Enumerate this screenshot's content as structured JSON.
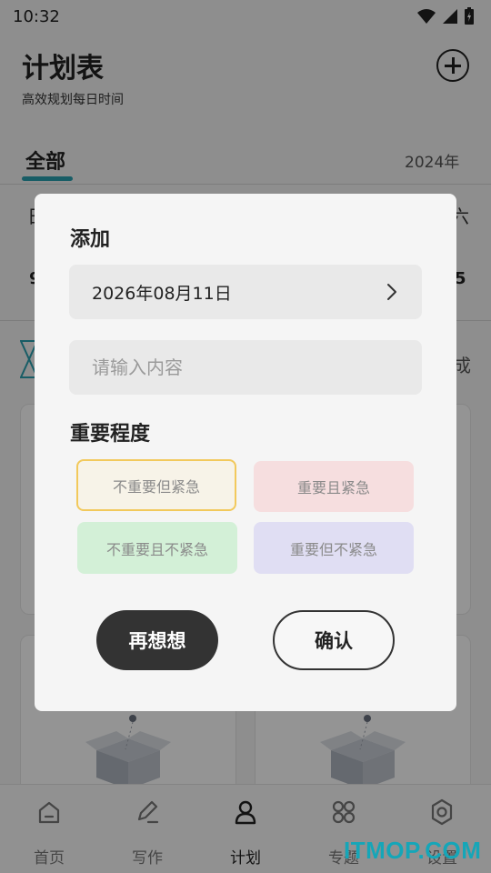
{
  "status_bar": {
    "time": "10:32"
  },
  "header": {
    "title": "计划表",
    "subtitle": "高效规划每日时间"
  },
  "tabs": {
    "active_label": "全部",
    "year": "2024年"
  },
  "week": {
    "left_weekday": "日",
    "right_weekday": "六",
    "left_day": "9",
    "right_day": "5"
  },
  "filter": {
    "right_label": "成"
  },
  "nav": {
    "items": [
      {
        "label": "首页",
        "icon": "home-icon"
      },
      {
        "label": "写作",
        "icon": "pencil-icon"
      },
      {
        "label": "计划",
        "icon": "person-icon",
        "active": true
      },
      {
        "label": "专题",
        "icon": "grid-icon"
      },
      {
        "label": "设置",
        "icon": "gear-icon"
      }
    ]
  },
  "watermark": "ITMOP.COM",
  "dialog": {
    "title": "添加",
    "date": "2026年08月11日",
    "content_placeholder": "请输入内容",
    "importance_label": "重要程度",
    "options": [
      {
        "label": "不重要但紧急",
        "selected": true,
        "color": "#f7f3e8",
        "border": "#f2c95c"
      },
      {
        "label": "重要且紧急",
        "selected": false,
        "color": "#f6dedf"
      },
      {
        "label": "不重要且不紧急",
        "selected": false,
        "color": "#d3f0d7"
      },
      {
        "label": "重要但不紧急",
        "selected": false,
        "color": "#e0def3"
      }
    ],
    "cancel_label": "再想想",
    "confirm_label": "确认"
  },
  "colors": {
    "accent": "#2aa0b0",
    "dark_button": "#333333"
  }
}
